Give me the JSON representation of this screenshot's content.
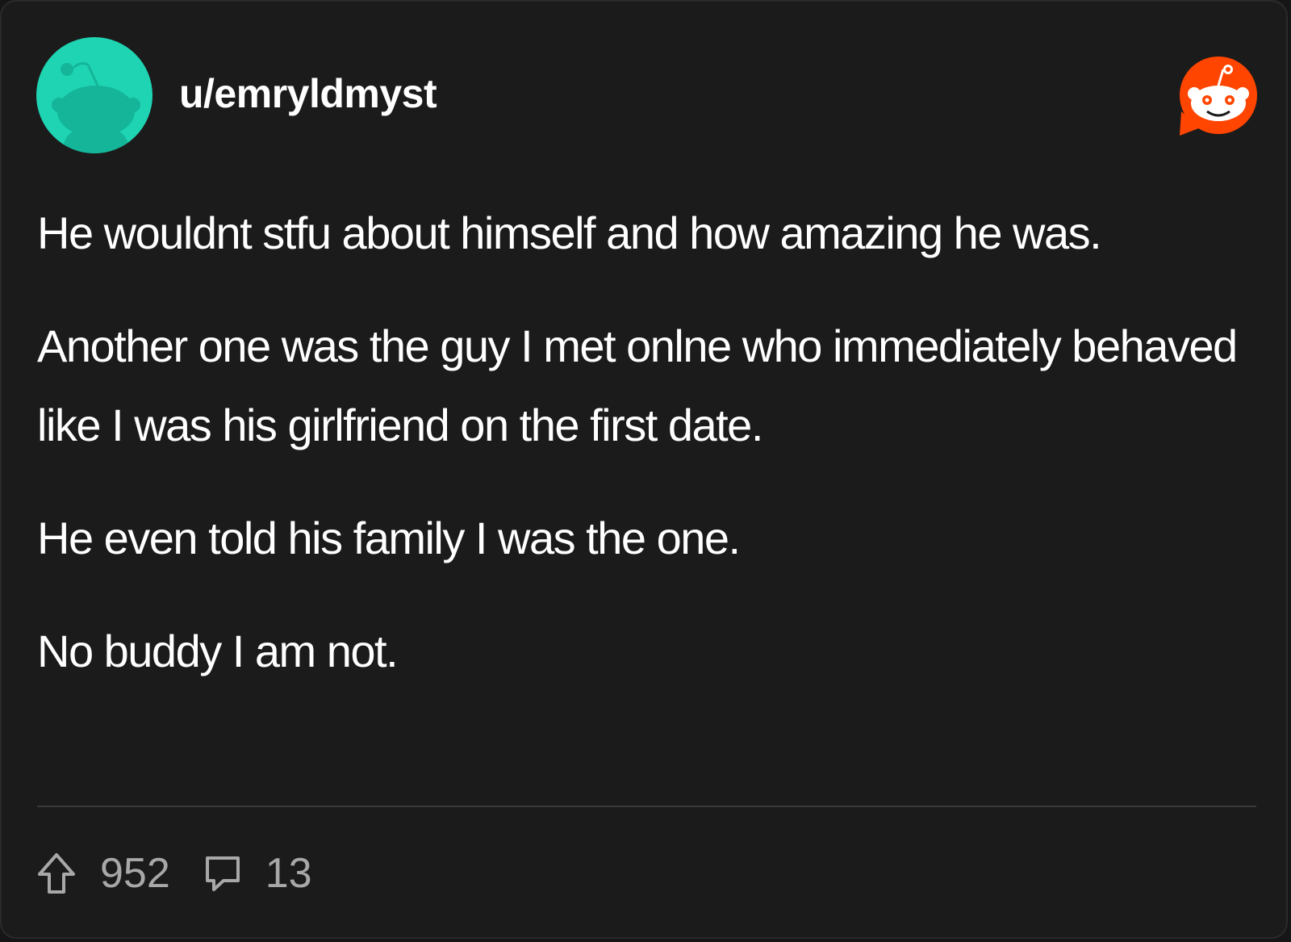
{
  "post": {
    "username": "u/emryldmyst",
    "paragraphs": [
      "He wouldnt stfu about himself and how amazing he was.",
      "Another one was the guy I met onlne who immediately behaved like I was his girlfriend on the first date.",
      "He even told his family I was the one.",
      "No buddy I am not."
    ]
  },
  "stats": {
    "upvotes": "952",
    "comments": "13"
  },
  "icons": {
    "avatar": "snoo-avatar-icon",
    "logo": "reddit-logo-icon",
    "upvote": "upvote-arrow-icon",
    "comment": "comment-bubble-icon"
  },
  "colors": {
    "background": "#1b1b1b",
    "avatar_teal": "#1fd4b2",
    "reddit_orange": "#ff4500",
    "text": "#ffffff",
    "muted": "#a8a8a8"
  }
}
